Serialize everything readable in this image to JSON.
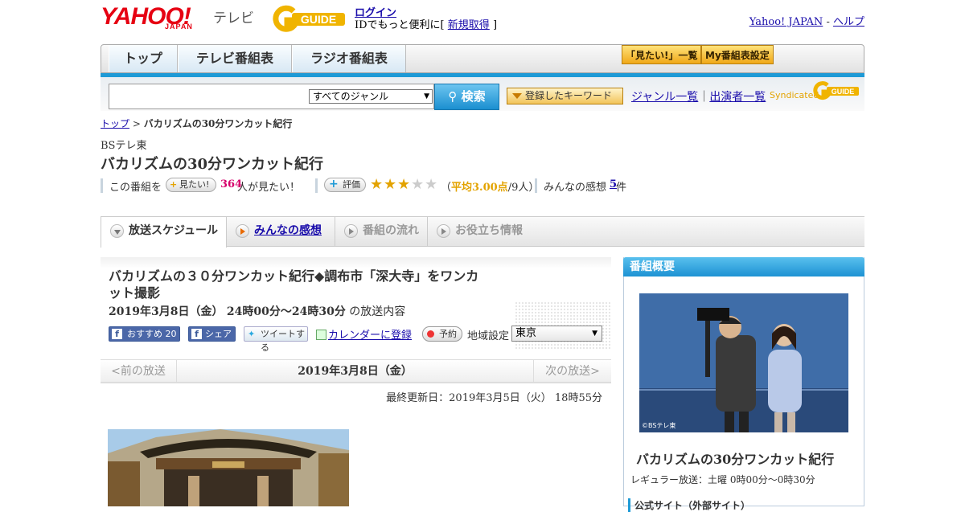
{
  "header": {
    "logo_yahoo": "YAHOO!",
    "logo_japan": "JAPAN",
    "logo_tv": "テレビ",
    "logo_gguide": "GUIDE",
    "login": "ログイン",
    "login_sub_prefix": "IDでもっと便利に[",
    "register": "新規取得",
    "login_sub_suffix": "]",
    "yahoo_japan": "Yahoo! JAPAN",
    "dash": " - ",
    "help": "ヘルプ"
  },
  "nav": {
    "tabs": [
      "トップ",
      "テレビ番組表",
      "ラジオ番組表"
    ],
    "want_list": "「見たい!」一覧",
    "my_schedule": "My番組表設定"
  },
  "search": {
    "genre": "すべてのジャンル",
    "search_btn": "検索",
    "keyword_btn": "登録したキーワード",
    "genre_list": "ジャンル一覧",
    "divider": "｜",
    "performers": "出演者一覧",
    "syndicated": "Syndicated"
  },
  "breadcrumb": {
    "top": "トップ",
    "sep": " > ",
    "current": "バカリズムの30分ワンカット紀行"
  },
  "program": {
    "channel": "BSテレ東",
    "title": "バカリズムの30分ワンカット紀行",
    "want_prefix": "この番組を",
    "want_btn": "見たい!",
    "want_count": "364",
    "want_suffix": "人が見たい！",
    "rating_btn": "評価",
    "rating_value": 3,
    "rating_max": 5,
    "rating_open": "（",
    "rating_score": "平均3.00点",
    "rating_people": "/9人）",
    "reviews_label": "みんなの感想",
    "reviews_count": "5",
    "reviews_unit": "件"
  },
  "tabs": {
    "schedule": "放送スケジュール",
    "reviews": "みんなの感想",
    "flow": "番組の流れ",
    "info": "お役立ち情報"
  },
  "episode": {
    "title": "バカリズムの３０分ワンカット紀行◆調布市「深大寺」をワンカット撮影",
    "date": "2019年3月8日（金）",
    "time": "24時00分～24時30分",
    "suffix": "の放送内容",
    "osusume": "おすすめ",
    "osusume_count": "20",
    "share": "シェア",
    "tweet": "ツイートする",
    "calendar": "カレンダーに登録",
    "yoyaku": "予約",
    "region_label": "地域設定",
    "region": "東京"
  },
  "datenav": {
    "prev": "<前の放送",
    "current": "2019年3月8日（金）",
    "next": "次の放送>"
  },
  "updated": "最終更新日：2019年3月5日（火） 18時55分",
  "sidebar": {
    "header": "番組概要",
    "copyright": "©BSテレ東",
    "title": "バカリズムの30分ワンカット紀行",
    "regular": "レギュラー放送：土曜 0時00分～0時30分",
    "official": "公式サイト（外部サイト）"
  },
  "colors": {
    "accent": "#1e9ad6",
    "brand": "#e60012",
    "want": "#d6006b",
    "star": "#e3a300"
  }
}
